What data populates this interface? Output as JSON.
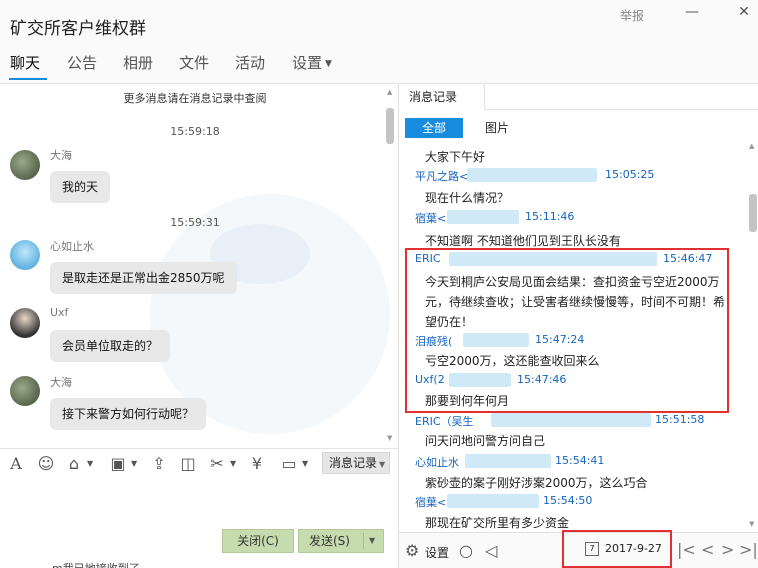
{
  "window": {
    "title": "矿交所客户维权群",
    "report_label": "举报",
    "minimize_icon": "minimize-icon",
    "close_icon": "close-icon"
  },
  "tabs": [
    {
      "label": "聊天",
      "active": true
    },
    {
      "label": "公告"
    },
    {
      "label": "相册"
    },
    {
      "label": "文件"
    },
    {
      "label": "活动"
    },
    {
      "label": "设置"
    }
  ],
  "chat": {
    "more_history": "更多消息请在消息记录中查阅",
    "timestamps": [
      "15:59:18",
      "15:59:31"
    ],
    "messages": [
      {
        "sender": "大海",
        "text": "我的天"
      },
      {
        "sender": "心如止水",
        "text": "是取走还是正常出金2850万呢"
      },
      {
        "sender": "Uxf",
        "text": "会员单位取走的？"
      },
      {
        "sender": "大海",
        "text": "接下来警方如何行动呢？"
      }
    ]
  },
  "toolbar": {
    "icons": [
      "font-icon",
      "emoji-icon",
      "shop-icon",
      "image-icon",
      "upload-icon",
      "gift-icon",
      "scissors-icon",
      "red-packet-icon",
      "screen-icon"
    ],
    "history_button": "消息记录"
  },
  "input": {
    "close_button": "关闭(C)",
    "send_button": "发送(S)",
    "cut_off_text": "m我已地接收到了"
  },
  "history": {
    "tab_label": "消息记录",
    "filter_all": "全部",
    "filter_images": "图片",
    "entries": [
      {
        "kind": "msg",
        "text": "大家下午好"
      },
      {
        "kind": "name",
        "name": "平凡之路<",
        "time": "15:05:25"
      },
      {
        "kind": "msg",
        "text": "现在什么情况？"
      },
      {
        "kind": "name",
        "name": "宿葉<",
        "time": "15:11:46"
      },
      {
        "kind": "msg",
        "text": "不知道啊   不知道他们见到王队长没有"
      },
      {
        "kind": "name",
        "name": "ERIC",
        "time": "15:46:47"
      },
      {
        "kind": "msg",
        "text": "今天到桐庐公安局见面会结果：查扣资金亏空近2000万元，待继续查收；让受害者继续慢慢等，时间不可期！希望仍在！"
      },
      {
        "kind": "name",
        "name": "泪痕残(",
        "time": "15:47:24"
      },
      {
        "kind": "msg",
        "text": "亏空2000万，这还能查收回来么"
      },
      {
        "kind": "name",
        "name": "Uxf(2",
        "time": "15:47:46"
      },
      {
        "kind": "msg",
        "text": "那要到何年何月"
      },
      {
        "kind": "name",
        "name": "ERIC（吴生",
        "time": "15:51:58"
      },
      {
        "kind": "msg",
        "text": "问天问地问警方问自己"
      },
      {
        "kind": "name",
        "name": "心如止水",
        "time": "15:54:41"
      },
      {
        "kind": "msg",
        "text": "紫砂壶的案子刚好涉案2000万，这么巧合"
      },
      {
        "kind": "name",
        "name": "宿葉<",
        "time": "15:54:50"
      },
      {
        "kind": "msg",
        "text": "那现在矿交所里有多少资金"
      }
    ],
    "settings_label": "设置",
    "date": "2017-9-27",
    "calendar_day": "7"
  },
  "colors": {
    "accent": "#1a8ce0",
    "highlight_box": "#e03030",
    "button_green": "#c7dcae"
  }
}
